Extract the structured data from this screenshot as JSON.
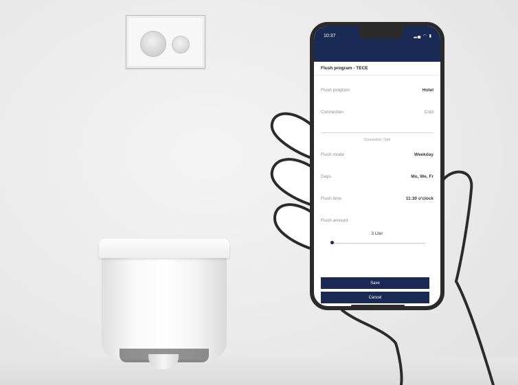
{
  "status_bar": {
    "time": "10:37",
    "icons": "▂▄ ◠ ▮"
  },
  "app": {
    "title": "Flush program - TECE"
  },
  "settings": [
    {
      "label": "Flush program",
      "value": "Hotel"
    },
    {
      "label": "Connection",
      "value": "Cold"
    }
  ],
  "section_label": "Connection: Cold",
  "schedule": [
    {
      "label": "Flush mode",
      "value": "Weekday"
    },
    {
      "label": "Days",
      "value": "Mo, We, Fr"
    },
    {
      "label": "Flush time",
      "value": "11:30 o'clock"
    }
  ],
  "flush_amount": {
    "label": "Flush amount",
    "value": "3 Liter",
    "level_fraction": 0.0
  },
  "buttons": {
    "save": "Save",
    "cancel": "Cancel"
  },
  "colors": {
    "accent": "#1b2a55",
    "phone_frame": "#2b2b2b"
  }
}
